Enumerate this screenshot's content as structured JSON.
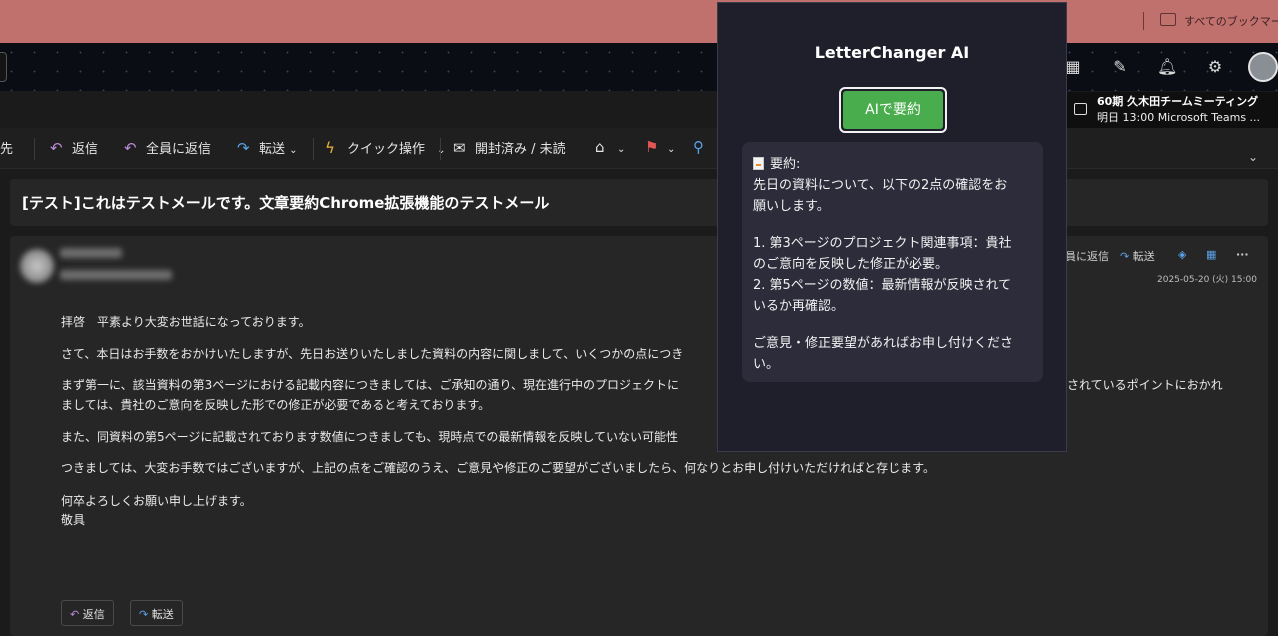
{
  "browser": {
    "bookmarks_label": "すべてのブックマーク"
  },
  "meeting": {
    "title": "60期 久木田チームミーティング",
    "detail": "明日 13:00 Microsoft Teams ..."
  },
  "ribbon": {
    "partial_label": "先",
    "reply": "返信",
    "reply_all": "全員に返信",
    "forward": "転送",
    "quick_actions": "クイック操作",
    "read_unread": "開封済み / 未読"
  },
  "subject": "[テスト]これはテストメールです。文章要約Chrome拡張機能のテストメール",
  "message": {
    "actions": {
      "reply_all_partial": "員に返信",
      "forward": "転送",
      "more": "···"
    },
    "date": "2025-05-20 (火) 15:00",
    "lines": [
      "拝啓　平素より大変お世話になっております。",
      "さて、本日はお手数をおかけいたしますが、先日お送りいたしました資料の内容に関しまして、いくつかの点につき",
      "まず第一に、該当資料の第3ページにおける記載内容につきましては、ご承知の通り、現在進行中のプロジェクトに",
      "されているポイントにおかれ",
      "ましては、貴社のご意向を反映した形での修正が必要であると考えております。",
      "また、同資料の第5ページに記載されております数値につきましても、現時点での最新情報を反映していない可能性",
      "つきましては、大変お手数ではございますが、上記の点をご確認のうえ、ご意見や修正のご要望がございましたら、何なりとお申し付けいただければと存じます。",
      "何卒よろしくお願い申し上げます。",
      "敬具"
    ],
    "bottom_reply": "返信",
    "bottom_forward": "転送"
  },
  "popup": {
    "title": "LetterChanger AI",
    "button": "AIで要約",
    "summary_lines": [
      "要約:",
      "先日の資料について、以下の2点の確認をお",
      "願いします。",
      "1. 第3ページのプロジェクト関連事項：貴社",
      "のご意向を反映した修正が必要。",
      "2. 第5ページの数値：最新情報が反映されて",
      "いるか再確認。",
      "ご意見・修正要望があればお申し付けくださ",
      "い。"
    ]
  },
  "colors": {
    "accent_green": "#49ac4d",
    "bookmark_bar": "#c0706d",
    "popup_bg": "#1f1f2c"
  }
}
